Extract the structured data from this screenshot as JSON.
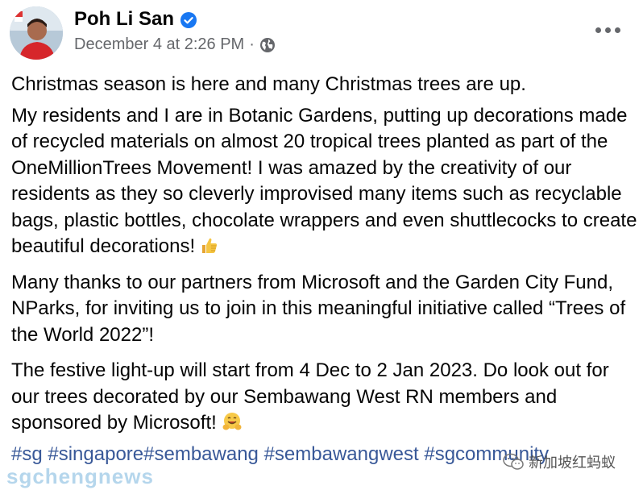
{
  "post": {
    "author": "Poh Li San",
    "timestamp": "December 4 at 2:26 PM",
    "separator": "·",
    "paragraphs": [
      "Christmas season is here and many Christmas trees are up.",
      "My residents and I are in Botanic Gardens, putting up decorations made of recycled materials on almost 20 tropical trees planted as part of the OneMillionTrees Movement! I was amazed by the creativity of our residents as they so cleverly improvised many items such as recyclable bags, plastic bottles, chocolate wrappers and even shuttlecocks to create beautiful decorations!",
      "Many thanks to our partners from Microsoft and the Garden City Fund, NParks, for inviting us to join in this meaningful initiative called “Trees of the World 2022”!",
      "The festive light-up will start from 4 Dec to 2 Jan 2023. Do look out for our trees decorated by our Sembawang West RN members and sponsored by Microsoft!"
    ],
    "hashtags": [
      "#sg",
      "#singapore",
      "#sembawang",
      "#sembawangwest",
      "#sgcommunity"
    ],
    "icons": {
      "verified": "verified-badge-icon",
      "audience": "globe-icon",
      "more": "more-options-icon",
      "emoji_p2": "thumbs-up-emoji",
      "emoji_p4": "hugging-face-emoji"
    }
  },
  "watermarks": {
    "wechat": "新加坡红蚂蚁",
    "site": "sgchengnews"
  },
  "colors": {
    "text": "#050505",
    "meta": "#65676b",
    "link": "#385898",
    "verified": "#1877f2"
  }
}
